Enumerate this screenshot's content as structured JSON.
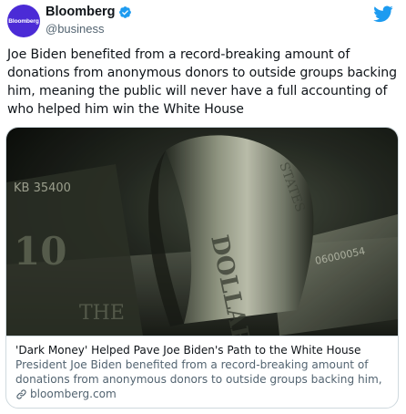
{
  "author": {
    "display_name": "Bloomberg",
    "handle": "@business",
    "avatar_text": "Bloomberg",
    "avatar_color": "#4b2bd6",
    "verified": true
  },
  "tweet": {
    "text": "Joe Biden benefited from a record-breaking amount of donations from anonymous donors to outside groups backing him, meaning the public will never have a full accounting of who helped him win the White House"
  },
  "link_card": {
    "image_icon": "dollar-bill-photo",
    "title": "'Dark Money' Helped Pave Joe Biden's Path to the White House",
    "description": "President Joe Biden benefited from a record-breaking amount of donations from anonymous donors to outside groups backing him, ...",
    "domain": "bloomberg.com"
  },
  "icons": {
    "platform": "twitter-bird-icon",
    "verified": "verified-badge-icon",
    "link": "link-icon"
  },
  "colors": {
    "twitter_blue": "#1d9bf0",
    "text_primary": "#0f1419",
    "text_secondary": "#536471",
    "border": "#cfd9de"
  }
}
